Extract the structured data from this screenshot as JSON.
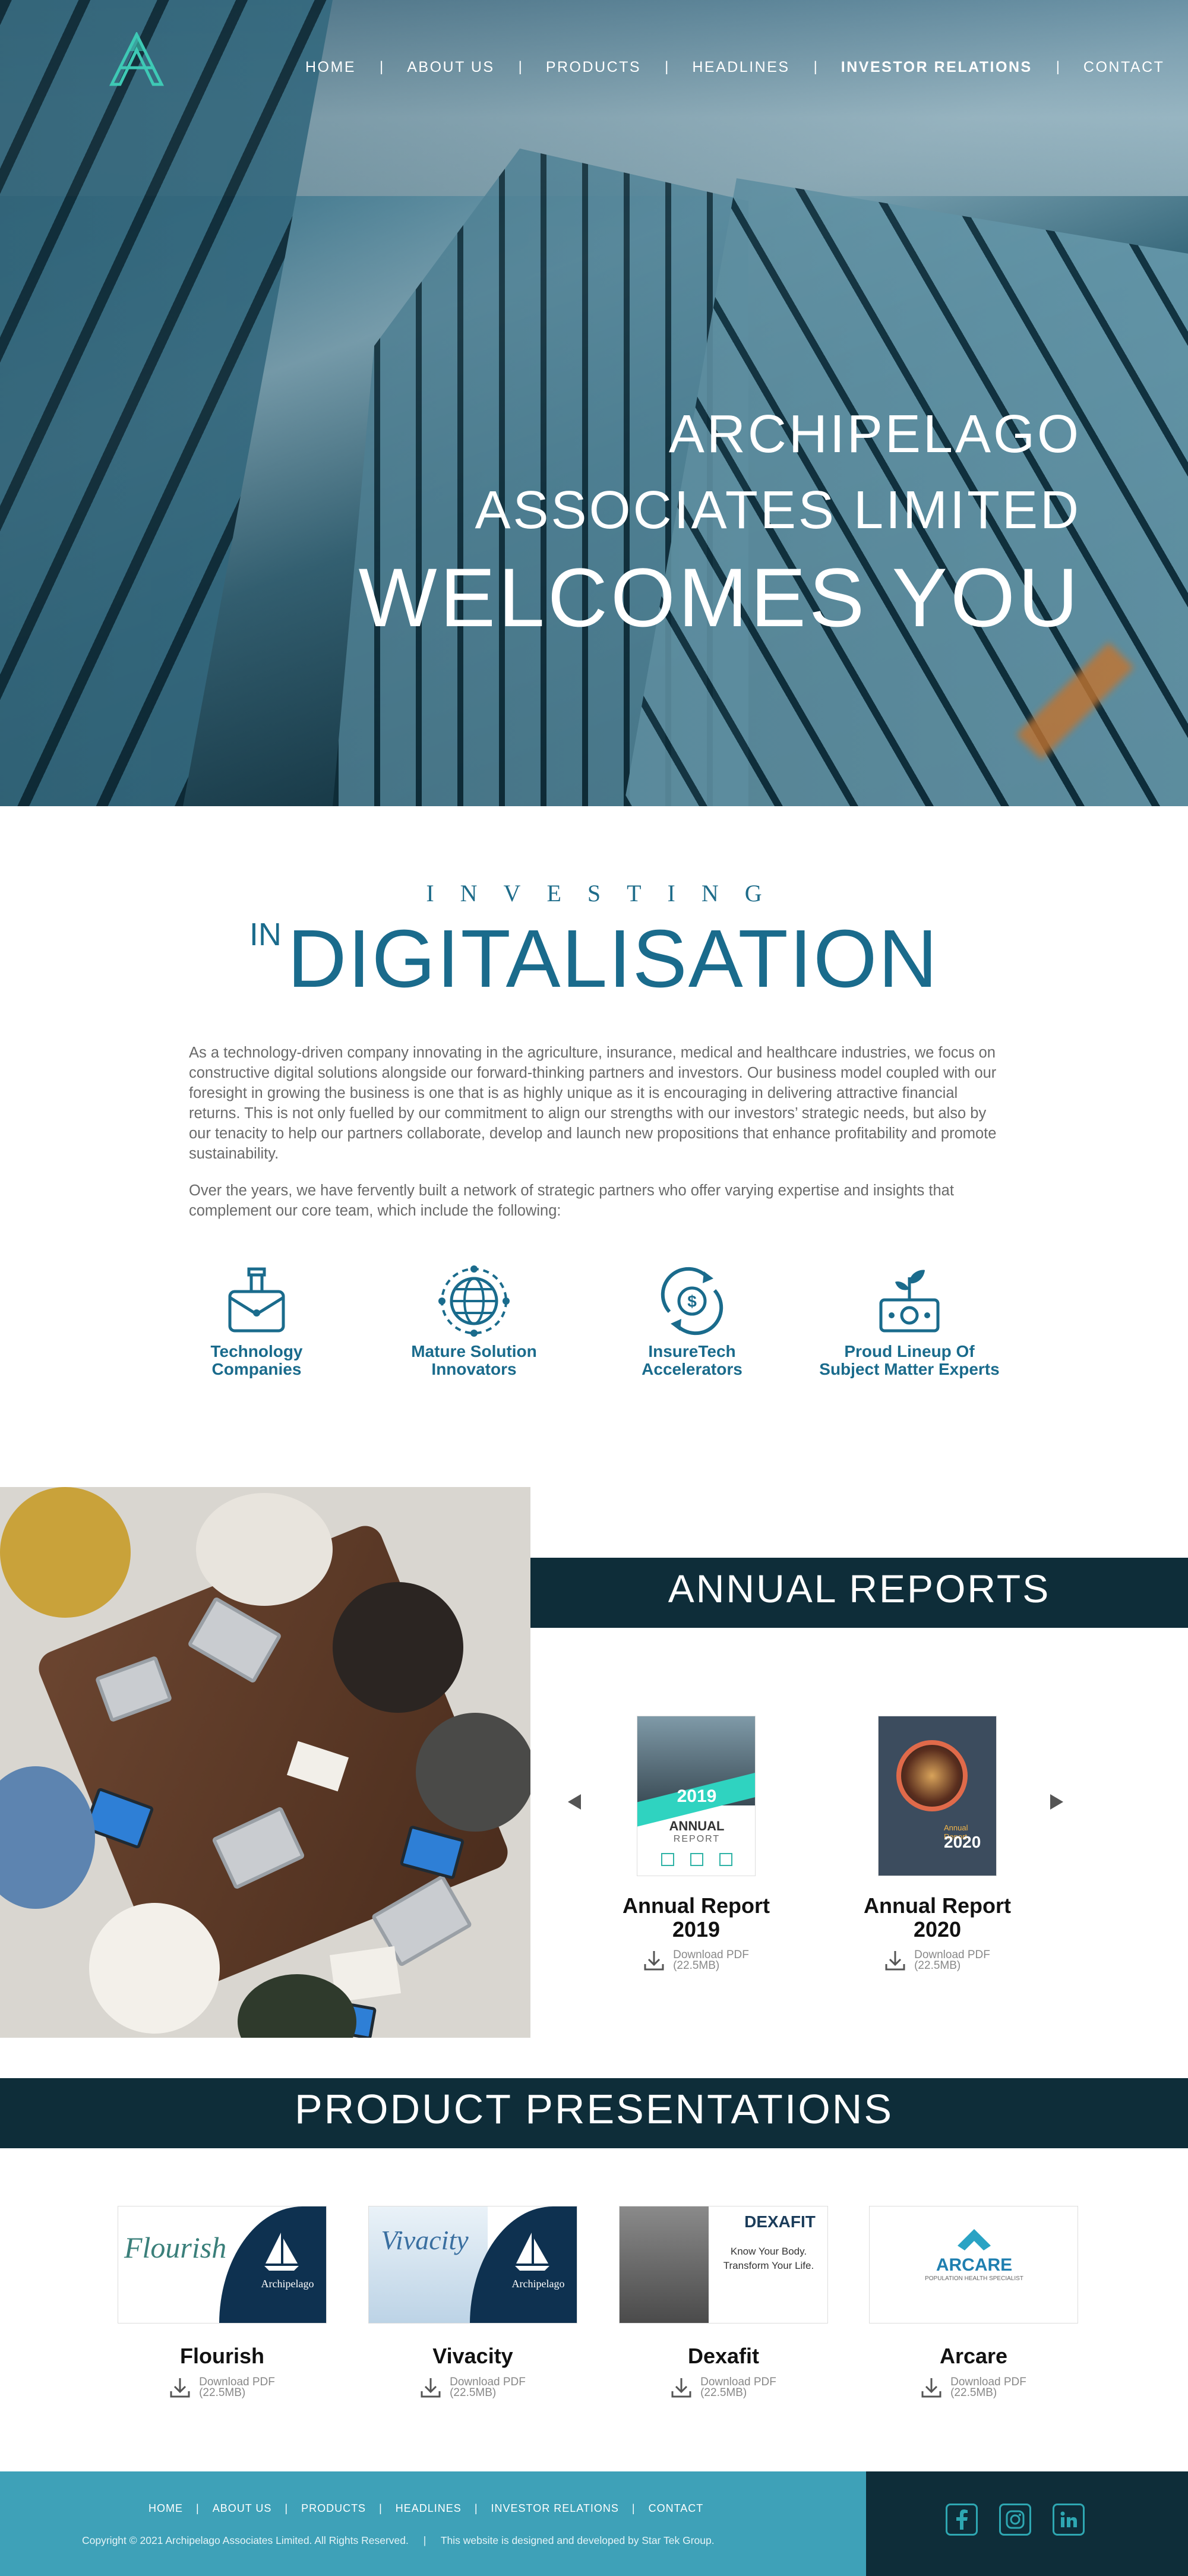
{
  "nav": {
    "items": [
      {
        "label": "HOME"
      },
      {
        "label": "ABOUT US"
      },
      {
        "label": "PRODUCTS"
      },
      {
        "label": "HEADLINES"
      },
      {
        "label": "INVESTOR RELATIONS",
        "active": true
      },
      {
        "label": "CONTACT"
      }
    ],
    "separator": "|"
  },
  "hero": {
    "line1": "ARCHIPELAGO",
    "line2": "ASSOCIATES LIMITED",
    "line3": "WELCOMES YOU"
  },
  "intro": {
    "kicker": "INVESTING",
    "in": "IN",
    "heading": "DIGITALISATION",
    "paragraph1": "As a technology-driven company innovating in the agriculture, insurance, medical and healthcare industries, we focus on constructive digital solutions alongside our forward-thinking partners and investors. Our business model coupled with our foresight in growing the business is one that is as highly unique as it is encouraging in delivering attractive financial returns. This is not only fuelled by our commitment to align our strengths with our investors’ strategic needs, but also by our tenacity to help our partners collaborate, develop and launch new propositions that enhance profitability and promote sustainability.",
    "paragraph2": "Over the years, we have fervently built a network of strategic partners who offer varying expertise and insights that complement our core team, which include the following:",
    "features": [
      {
        "line1": "Technology",
        "line2": "Companies",
        "icon": "briefcase-icon"
      },
      {
        "line1": "Mature Solution",
        "line2": "Innovators",
        "icon": "globe-icon"
      },
      {
        "line1": "InsureTech",
        "line2": "Accelerators",
        "icon": "dollar-cycle-icon"
      },
      {
        "line1": "Proud Lineup Of",
        "line2": "Subject Matter Experts",
        "icon": "plant-money-icon"
      }
    ]
  },
  "annual_reports": {
    "title": "ANNUAL REPORTS",
    "prev_icon": "triangle-left-icon",
    "next_icon": "triangle-right-icon",
    "reports": [
      {
        "line1": "Annual Report",
        "line2": "2019",
        "cover_year": "2019",
        "cover_word": "ANNUAL",
        "cover_sub": "REPORT",
        "download": "Download PDF",
        "size": "(22.5MB)"
      },
      {
        "line1": "Annual Report",
        "line2": "2020",
        "cover_year": "2020",
        "cover_sub": "Annual Report",
        "download": "Download PDF",
        "size": "(22.5MB)"
      }
    ]
  },
  "products": {
    "title": "PRODUCT PRESENTATIONS",
    "items": [
      {
        "name": "Flourish",
        "brand": "Flourish",
        "partner": "Archipelago",
        "download": "Download PDF",
        "size": "(22.5MB)"
      },
      {
        "name": "Vivacity",
        "brand": "Vivacity",
        "partner": "Archipelago",
        "download": "Download PDF",
        "size": "(22.5MB)"
      },
      {
        "name": "Dexafit",
        "brand": "DEXAFIT",
        "tag1": "Know Your Body.",
        "tag2": "Transform Your Life.",
        "download": "Download PDF",
        "size": "(22.5MB)"
      },
      {
        "name": "Arcare",
        "brand": "ARCARE",
        "tag1": "POPULATION HEALTH SPECIALIST",
        "download": "Download PDF",
        "size": "(22.5MB)"
      }
    ]
  },
  "footer": {
    "nav": [
      "HOME",
      "ABOUT US",
      "PRODUCTS",
      "HEADLINES",
      "INVESTOR RELATIONS",
      "CONTACT"
    ],
    "copyright": "Copyright © 2021 Archipelago Associates Limited. All Rights Reserved.",
    "credit": "This website is designed and developed by Star Tek Group.",
    "social": [
      "facebook-icon",
      "instagram-icon",
      "linkedin-icon"
    ]
  },
  "colors": {
    "accent": "#1a6b8c",
    "band": "#0e2d39",
    "footer": "#3ea1b8",
    "social": "#2ea7b2"
  }
}
